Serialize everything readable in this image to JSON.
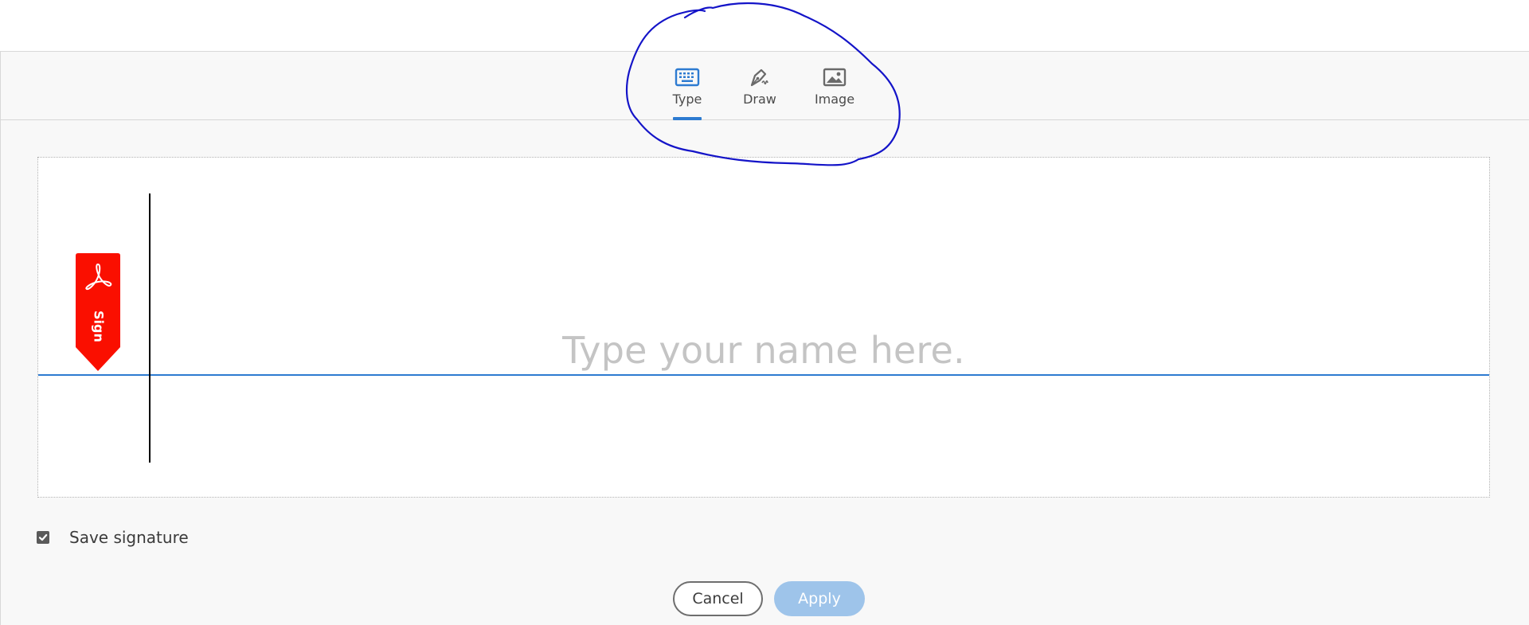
{
  "tabs": [
    {
      "label": "Type",
      "icon": "keyboard-icon",
      "active": true
    },
    {
      "label": "Draw",
      "icon": "pen-icon",
      "active": false
    },
    {
      "label": "Image",
      "icon": "image-icon",
      "active": false
    }
  ],
  "signature": {
    "placeholder": "Type your name here.",
    "sign_flag_text": "Sign"
  },
  "save_signature": {
    "label": "Save signature",
    "checked": true
  },
  "buttons": {
    "cancel": "Cancel",
    "apply": "Apply"
  },
  "colors": {
    "accent": "#2d7bd1",
    "sign_flag": "#fa0f00",
    "apply_disabled": "#9ec4ea",
    "annotation": "#1414c8"
  }
}
